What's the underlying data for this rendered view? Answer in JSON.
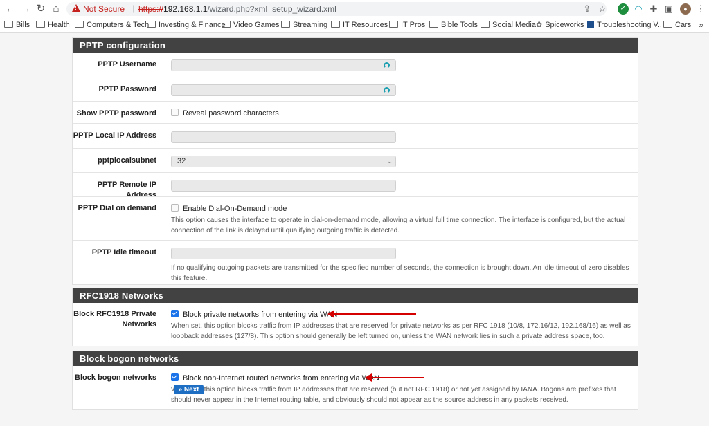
{
  "browser": {
    "security_label": "Not Secure",
    "url_scheme": "https://",
    "url_host": "192.168.1.1",
    "url_path": "/wizard.php?xml=setup_wizard.xml",
    "bookmarks": [
      "Bills",
      "Health",
      "Computers & Tech",
      "Investing & Finance",
      "Video Games",
      "Streaming",
      "IT Resources",
      "IT Pros",
      "Bible Tools",
      "Social Media",
      "Spiceworks",
      "Troubleshooting V...",
      "Cars"
    ],
    "bookmarks_more": "»"
  },
  "pptp": {
    "title": "PPTP configuration",
    "username_label": "PPTP Username",
    "username_value": "",
    "password_label": "PPTP Password",
    "password_value": "",
    "show_password_label": "Show PPTP password",
    "show_password_checkbox": "Reveal password characters",
    "local_ip_label": "PPTP Local IP Address",
    "local_ip_value": "",
    "subnet_label": "pptplocalsubnet",
    "subnet_value": "32",
    "remote_ip_label": "PPTP Remote IP Address",
    "remote_ip_value": "",
    "dial_label": "PPTP Dial on demand",
    "dial_checkbox": "Enable Dial-On-Demand mode",
    "dial_help_1": "This option causes the interface to operate in dial-on-demand mode, allowing a virtual full time connection. The interface is configured, but the actual",
    "dial_help_2": "connection of the link is delayed until qualifying outgoing traffic is detected.",
    "idle_label": "PPTP Idle timeout",
    "idle_value": "",
    "idle_help_1": "If no qualifying outgoing packets are transmitted for the specified number of seconds, the connection is brought down. An idle timeout of zero disables",
    "idle_help_2": "this feature."
  },
  "rfc1918": {
    "title": "RFC1918 Networks",
    "label_1": "Block RFC1918 Private",
    "label_2": "Networks",
    "checkbox": "Block private networks from entering via WAN",
    "checked": true,
    "help_1": "When set, this option blocks traffic from IP addresses that are reserved for private networks as per RFC 1918 (10/8, 172.16/12, 192.168/16) as well as",
    "help_2": "loopback addresses (127/8). This option should generally be left turned on, unless the WAN network lies in such a private address space, too."
  },
  "bogon": {
    "title": "Block bogon networks",
    "label": "Block bogon networks",
    "checkbox": "Block non-Internet routed networks from entering via WAN",
    "checked": true,
    "help_1": "When set, this option blocks traffic from IP addresses that are reserved (but not RFC 1918) or not yet assigned by IANA. Bogons are prefixes that",
    "help_2": "should never appear in the Internet routing table, and obviously should not appear as the source address in any packets received."
  },
  "footer": {
    "next_label": "»  Next"
  },
  "colors": {
    "panel_header": "#424242",
    "primary_button": "#1e6fc4",
    "annotation_arrow": "#d40000",
    "checkbox_on": "#1a73e8"
  }
}
